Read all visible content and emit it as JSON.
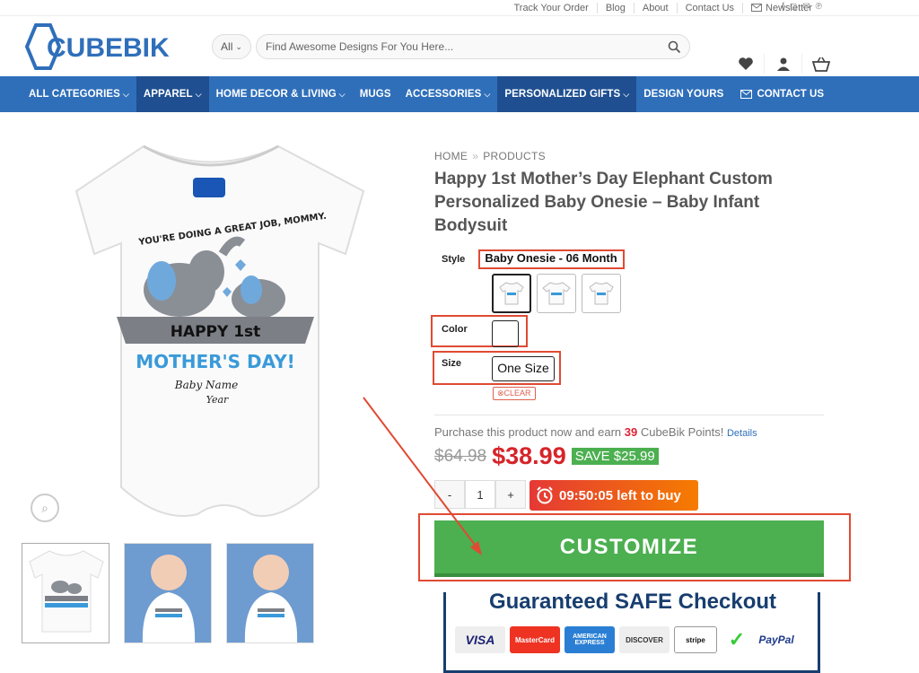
{
  "topbar": {
    "links": [
      "Track Your Order",
      "Blog",
      "About",
      "Contact Us"
    ],
    "newsletter": "Newsletter"
  },
  "brand": {
    "name": "CUBEBIK",
    "accent": "#2f6fba",
    "dark": "#173e6f"
  },
  "search": {
    "category": "All",
    "placeholder": "Find Awesome Designs For You Here..."
  },
  "nav": {
    "items": [
      "ALL CATEGORIES",
      "APPAREL",
      "HOME DECOR & LIVING",
      "MUGS",
      "ACCESSORIES",
      "PERSONALIZED GIFTS",
      "DESIGN YOURS"
    ],
    "contact": "CONTACT US"
  },
  "breadcrumb": {
    "home": "HOME",
    "sep": "»",
    "current": "PRODUCTS"
  },
  "product": {
    "title": "Happy 1st Mother’s Day Elephant Custom Personalized Baby Onesie – Baby Infant Bodysuit",
    "style_label": "Style",
    "style_value": "Baby Onesie - 06 Month",
    "color_label": "Color",
    "size_label": "Size",
    "size_value": "One Size",
    "clear": "⊗CLEAR",
    "points_pre": "Purchase this product now and earn ",
    "points": "39",
    "points_post": " CubeBik Points!",
    "details": "Details",
    "old_price": "$64.98",
    "price": "$38.99",
    "save": "SAVE $25.99",
    "qty": "1",
    "timer": "09:50:05 left to buy",
    "customize": "CUSTOMIZE"
  },
  "artwork": {
    "line1": "YOU'RE DOING A GREAT JOB, MOMMY.",
    "line2": "HAPPY 1st",
    "line3": "MOTHER'S DAY!",
    "line4": "Baby Name",
    "line5": "Year"
  },
  "checkout": {
    "title": "Guaranteed SAFE Checkout",
    "cards": [
      "VISA",
      "MasterCard",
      "AMERICAN EXPRESS",
      "DISCOVER",
      "stripe",
      "✓",
      "PayPal"
    ]
  }
}
